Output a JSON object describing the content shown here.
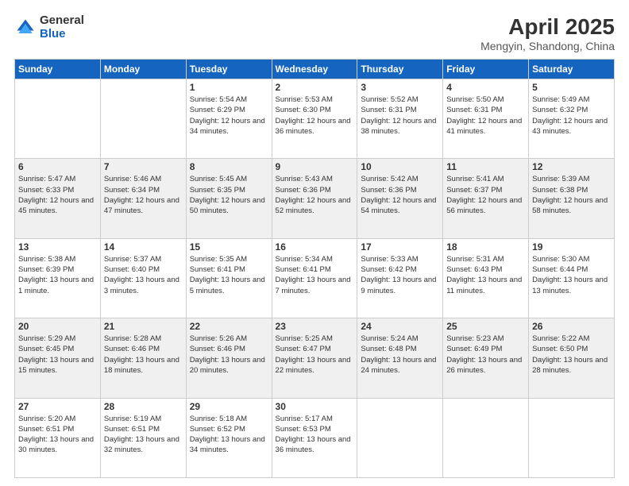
{
  "logo": {
    "general": "General",
    "blue": "Blue"
  },
  "title": {
    "month": "April 2025",
    "location": "Mengyin, Shandong, China"
  },
  "weekdays": [
    "Sunday",
    "Monday",
    "Tuesday",
    "Wednesday",
    "Thursday",
    "Friday",
    "Saturday"
  ],
  "weeks": [
    [
      {
        "day": "",
        "info": ""
      },
      {
        "day": "",
        "info": ""
      },
      {
        "day": "1",
        "info": "Sunrise: 5:54 AM\nSunset: 6:29 PM\nDaylight: 12 hours and 34 minutes."
      },
      {
        "day": "2",
        "info": "Sunrise: 5:53 AM\nSunset: 6:30 PM\nDaylight: 12 hours and 36 minutes."
      },
      {
        "day": "3",
        "info": "Sunrise: 5:52 AM\nSunset: 6:31 PM\nDaylight: 12 hours and 38 minutes."
      },
      {
        "day": "4",
        "info": "Sunrise: 5:50 AM\nSunset: 6:31 PM\nDaylight: 12 hours and 41 minutes."
      },
      {
        "day": "5",
        "info": "Sunrise: 5:49 AM\nSunset: 6:32 PM\nDaylight: 12 hours and 43 minutes."
      }
    ],
    [
      {
        "day": "6",
        "info": "Sunrise: 5:47 AM\nSunset: 6:33 PM\nDaylight: 12 hours and 45 minutes."
      },
      {
        "day": "7",
        "info": "Sunrise: 5:46 AM\nSunset: 6:34 PM\nDaylight: 12 hours and 47 minutes."
      },
      {
        "day": "8",
        "info": "Sunrise: 5:45 AM\nSunset: 6:35 PM\nDaylight: 12 hours and 50 minutes."
      },
      {
        "day": "9",
        "info": "Sunrise: 5:43 AM\nSunset: 6:36 PM\nDaylight: 12 hours and 52 minutes."
      },
      {
        "day": "10",
        "info": "Sunrise: 5:42 AM\nSunset: 6:36 PM\nDaylight: 12 hours and 54 minutes."
      },
      {
        "day": "11",
        "info": "Sunrise: 5:41 AM\nSunset: 6:37 PM\nDaylight: 12 hours and 56 minutes."
      },
      {
        "day": "12",
        "info": "Sunrise: 5:39 AM\nSunset: 6:38 PM\nDaylight: 12 hours and 58 minutes."
      }
    ],
    [
      {
        "day": "13",
        "info": "Sunrise: 5:38 AM\nSunset: 6:39 PM\nDaylight: 13 hours and 1 minute."
      },
      {
        "day": "14",
        "info": "Sunrise: 5:37 AM\nSunset: 6:40 PM\nDaylight: 13 hours and 3 minutes."
      },
      {
        "day": "15",
        "info": "Sunrise: 5:35 AM\nSunset: 6:41 PM\nDaylight: 13 hours and 5 minutes."
      },
      {
        "day": "16",
        "info": "Sunrise: 5:34 AM\nSunset: 6:41 PM\nDaylight: 13 hours and 7 minutes."
      },
      {
        "day": "17",
        "info": "Sunrise: 5:33 AM\nSunset: 6:42 PM\nDaylight: 13 hours and 9 minutes."
      },
      {
        "day": "18",
        "info": "Sunrise: 5:31 AM\nSunset: 6:43 PM\nDaylight: 13 hours and 11 minutes."
      },
      {
        "day": "19",
        "info": "Sunrise: 5:30 AM\nSunset: 6:44 PM\nDaylight: 13 hours and 13 minutes."
      }
    ],
    [
      {
        "day": "20",
        "info": "Sunrise: 5:29 AM\nSunset: 6:45 PM\nDaylight: 13 hours and 15 minutes."
      },
      {
        "day": "21",
        "info": "Sunrise: 5:28 AM\nSunset: 6:46 PM\nDaylight: 13 hours and 18 minutes."
      },
      {
        "day": "22",
        "info": "Sunrise: 5:26 AM\nSunset: 6:46 PM\nDaylight: 13 hours and 20 minutes."
      },
      {
        "day": "23",
        "info": "Sunrise: 5:25 AM\nSunset: 6:47 PM\nDaylight: 13 hours and 22 minutes."
      },
      {
        "day": "24",
        "info": "Sunrise: 5:24 AM\nSunset: 6:48 PM\nDaylight: 13 hours and 24 minutes."
      },
      {
        "day": "25",
        "info": "Sunrise: 5:23 AM\nSunset: 6:49 PM\nDaylight: 13 hours and 26 minutes."
      },
      {
        "day": "26",
        "info": "Sunrise: 5:22 AM\nSunset: 6:50 PM\nDaylight: 13 hours and 28 minutes."
      }
    ],
    [
      {
        "day": "27",
        "info": "Sunrise: 5:20 AM\nSunset: 6:51 PM\nDaylight: 13 hours and 30 minutes."
      },
      {
        "day": "28",
        "info": "Sunrise: 5:19 AM\nSunset: 6:51 PM\nDaylight: 13 hours and 32 minutes."
      },
      {
        "day": "29",
        "info": "Sunrise: 5:18 AM\nSunset: 6:52 PM\nDaylight: 13 hours and 34 minutes."
      },
      {
        "day": "30",
        "info": "Sunrise: 5:17 AM\nSunset: 6:53 PM\nDaylight: 13 hours and 36 minutes."
      },
      {
        "day": "",
        "info": ""
      },
      {
        "day": "",
        "info": ""
      },
      {
        "day": "",
        "info": ""
      }
    ]
  ]
}
